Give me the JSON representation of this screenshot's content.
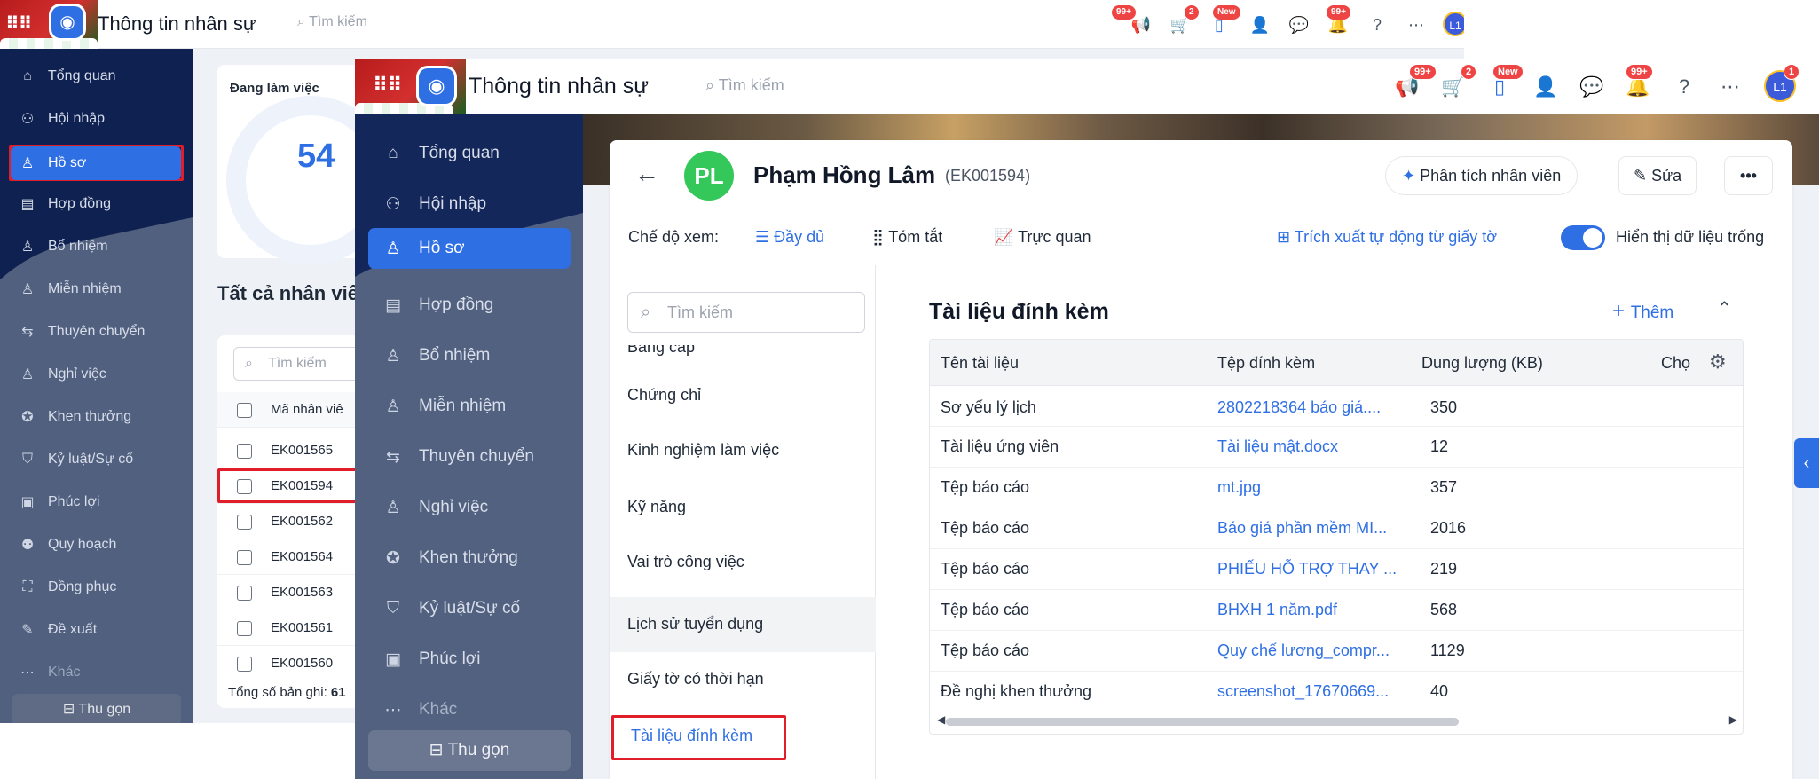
{
  "app": {
    "title": "Thông tin nhân sự",
    "search_placeholder": "Tìm kiếm",
    "logo_letter": "◉",
    "badges": {
      "announce": "99+",
      "cart": "2",
      "mobile": "New",
      "notify": "99+",
      "avatar_count": "1"
    },
    "user_initials": "L1"
  },
  "sidebar": {
    "items": [
      {
        "label": "Tổng quan",
        "icon": "home-icon"
      },
      {
        "label": "Hội nhập",
        "icon": "team-icon"
      },
      {
        "label": "Hồ sơ",
        "icon": "user-icon"
      },
      {
        "label": "Hợp đồng",
        "icon": "document-icon"
      },
      {
        "label": "Bổ nhiệm",
        "icon": "user-plus-icon"
      },
      {
        "label": "Miễn nhiệm",
        "icon": "user-minus-icon"
      },
      {
        "label": "Thuyên chuyển",
        "icon": "transfer-icon"
      },
      {
        "label": "Nghỉ việc",
        "icon": "user-leave-icon"
      },
      {
        "label": "Khen thưởng",
        "icon": "award-icon"
      },
      {
        "label": "Kỷ luật/Sự cố",
        "icon": "shield-icon"
      },
      {
        "label": "Phúc lợi",
        "icon": "benefit-icon"
      },
      {
        "label": "Quy hoạch",
        "icon": "plan-icon"
      },
      {
        "label": "Đồng phục",
        "icon": "shirt-icon"
      },
      {
        "label": "Đề xuất",
        "icon": "proposal-icon"
      },
      {
        "label": "Khác",
        "icon": "more-icon"
      }
    ],
    "collapse_label": "Thu gọn"
  },
  "back_page": {
    "stat_label": "Đang làm việc",
    "stat_value": "54",
    "list_title": "Tất cả nhân viê",
    "search_placeholder": "Tìm kiếm",
    "column_header": "Mã nhân viê",
    "rows": [
      "EK001565",
      "EK001594",
      "EK001562",
      "EK001564",
      "EK001563",
      "EK001561",
      "EK001560"
    ],
    "total_label": "Tổng số bản ghi:",
    "total_value": "61"
  },
  "employee": {
    "initials": "PL",
    "name": "Phạm Hồng Lâm",
    "code": "(EK001594)",
    "analyze_label": "Phân tích nhân viên",
    "edit_label": "Sửa",
    "more_label": "•••"
  },
  "view_bar": {
    "mode_label": "Chế độ xem:",
    "modes": [
      "Đầy đủ",
      "Tóm tắt",
      "Trực quan"
    ],
    "active_mode": "Đầy đủ",
    "extract_label": "Trích xuất tự động từ giấy tờ",
    "toggle_label": "Hiển thị dữ liệu trống",
    "toggle_on": true
  },
  "profile_nav": {
    "search_placeholder": "Tìm kiếm",
    "items": [
      "Bằng cấp",
      "Chứng chỉ",
      "Kinh nghiệm làm việc",
      "Kỹ năng",
      "Vai trò công việc",
      "Lịch sử tuyển dụng",
      "Giấy tờ có thời hạn",
      "Tài liệu đính kèm"
    ],
    "highlighted": "Lịch sử tuyển dụng",
    "selected": "Tài liệu đính kèm"
  },
  "attachments": {
    "title": "Tài liệu đính kèm",
    "add_label": "Thêm",
    "columns": [
      "Tên tài liệu",
      "Tệp đính kèm",
      "Dung lượng (KB)",
      "Chọ"
    ],
    "rows": [
      {
        "name": "Sơ yếu lý lịch",
        "file": "2802218364 báo giá....",
        "size": "350"
      },
      {
        "name": "Tài liệu ứng viên",
        "file": "Tài liệu mật.docx",
        "size": "12"
      },
      {
        "name": "Tệp báo cáo",
        "file": "mt.jpg",
        "size": "357"
      },
      {
        "name": "Tệp báo cáo",
        "file": "Báo giá phần mềm MI...",
        "size": "2016"
      },
      {
        "name": "Tệp báo cáo",
        "file": "PHIẾU HỖ TRỢ THAY ...",
        "size": "219"
      },
      {
        "name": "Tệp báo cáo",
        "file": "BHXH 1 năm.pdf",
        "size": "568"
      },
      {
        "name": "Tệp báo cáo",
        "file": "Quy chế lương_compr...",
        "size": "1129"
      },
      {
        "name": "Đề nghị khen thưởng",
        "file": "screenshot_17670669...",
        "size": "40"
      }
    ]
  },
  "colors": {
    "accent": "#2f6fe4",
    "sidebar": "#14275a",
    "highlight_box": "#e11d2a",
    "avatar": "#34c759"
  }
}
